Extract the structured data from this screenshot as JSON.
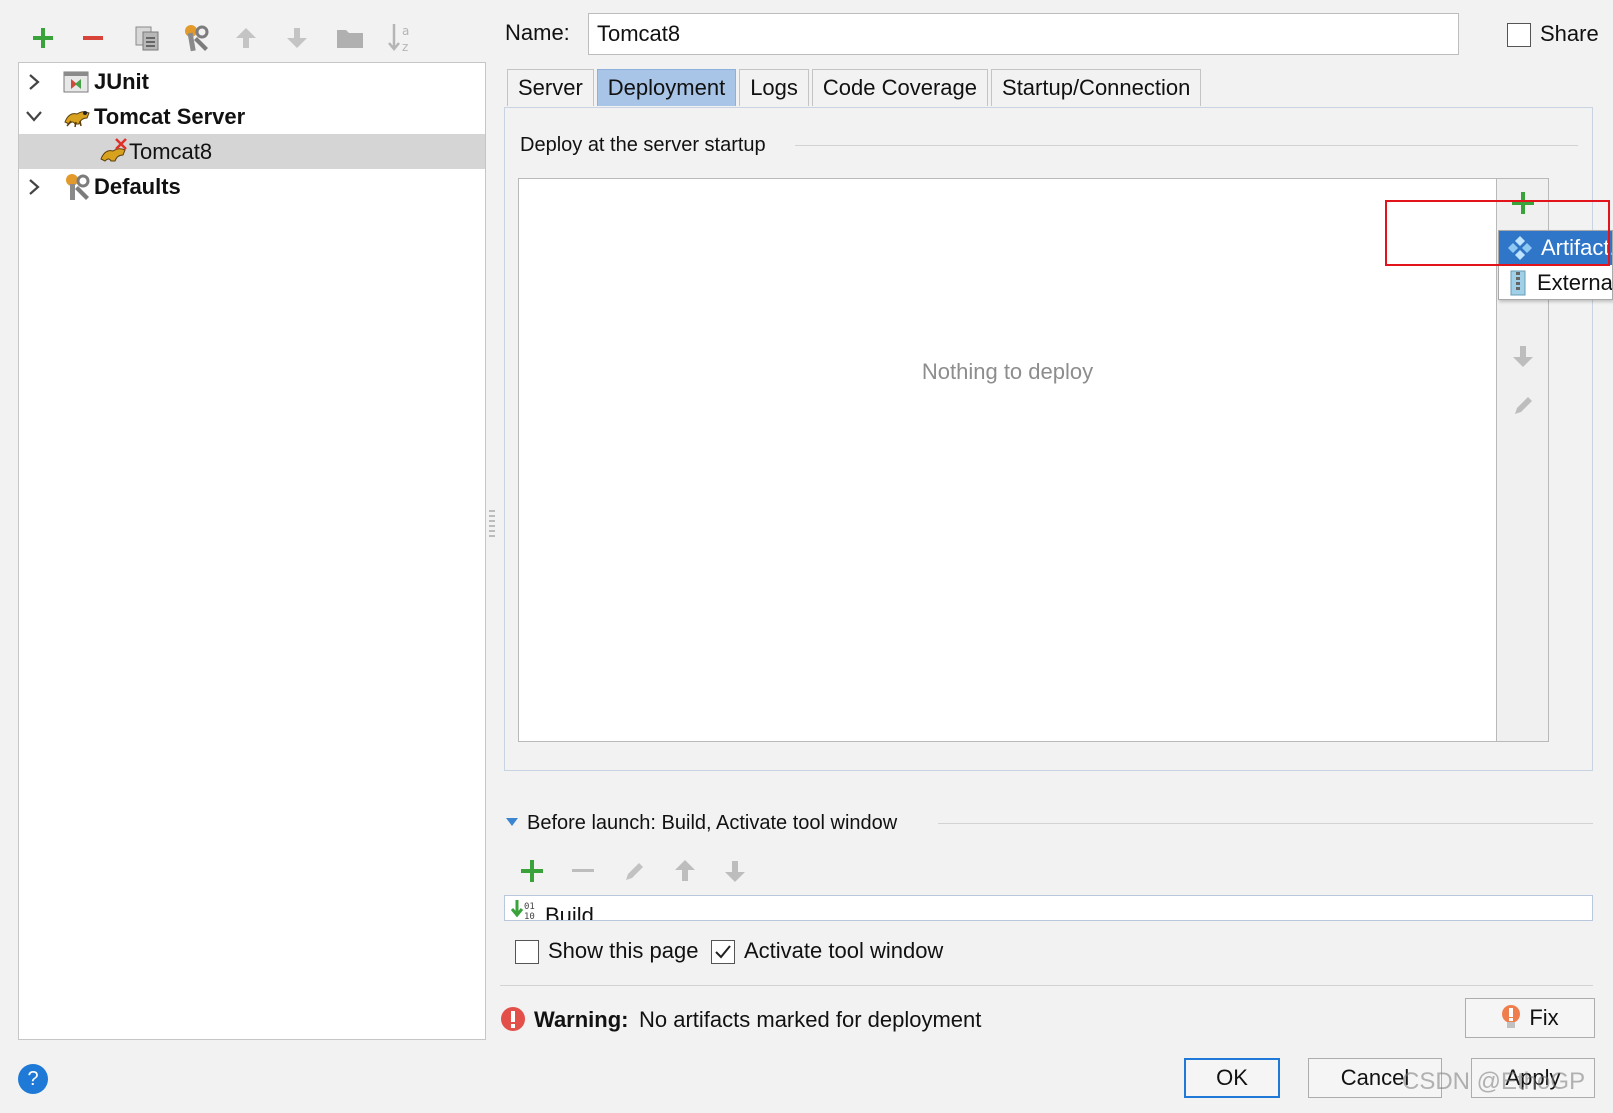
{
  "tree": {
    "items": [
      {
        "label": "JUnit"
      },
      {
        "label": "Tomcat Server"
      },
      {
        "label": "Tomcat8"
      },
      {
        "label": "Defaults"
      }
    ]
  },
  "header": {
    "name_label": "Name:",
    "name_value": "Tomcat8",
    "share_label": "Share"
  },
  "tabs": [
    {
      "label": "Server"
    },
    {
      "label": "Deployment"
    },
    {
      "label": "Logs"
    },
    {
      "label": "Code Coverage"
    },
    {
      "label": "Startup/Connection"
    }
  ],
  "deployment": {
    "section_title": "Deploy at the server startup",
    "empty_text": "Nothing to deploy",
    "popup_items": [
      {
        "label": "Artifact..."
      },
      {
        "label": "External Source..."
      }
    ]
  },
  "before_launch": {
    "title": "Before launch: Build, Activate tool window",
    "item": "Build"
  },
  "options": {
    "show_page": "Show this page",
    "activate_window": "Activate tool window"
  },
  "warning": {
    "bold": "Warning:",
    "text": "No artifacts marked for deployment",
    "fix_label": "Fix"
  },
  "buttons": {
    "ok": "OK",
    "cancel": "Cancel",
    "apply": "Apply"
  },
  "watermark": "CSDN @EthoGP",
  "colors": {
    "accent": "#2f76c8",
    "tab_active": "#a8c4e6",
    "add_green": "#3aa23a",
    "remove_red": "#d9443a",
    "highlight_red": "#e3131b"
  }
}
